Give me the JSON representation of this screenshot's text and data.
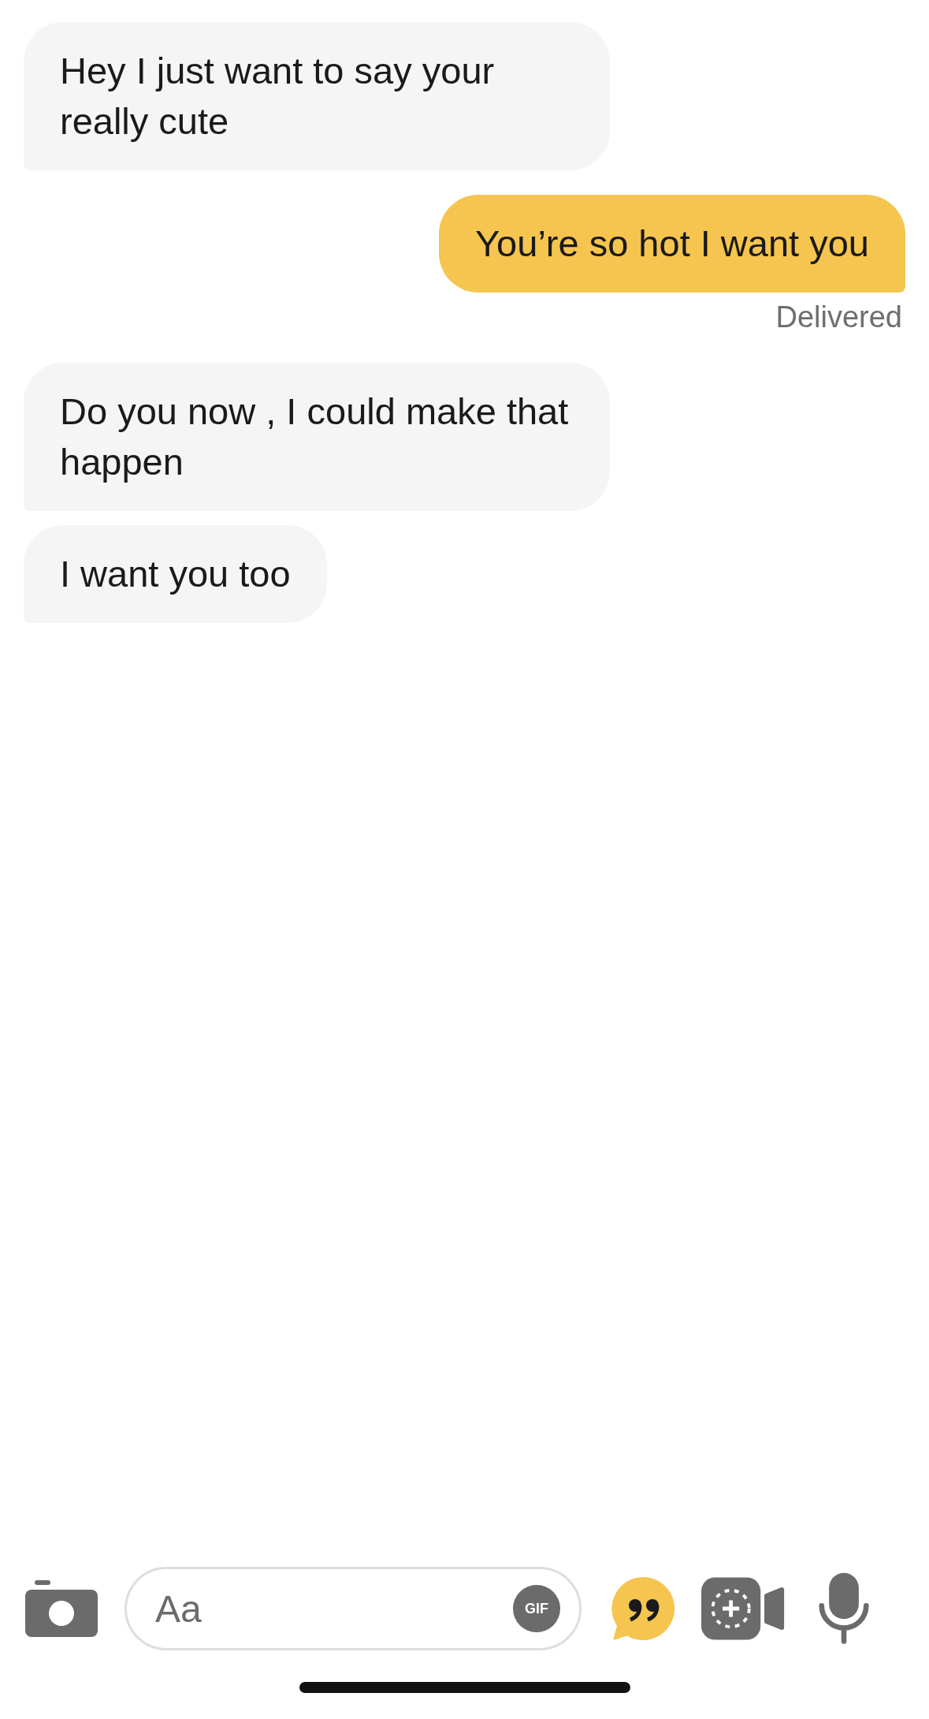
{
  "messages": [
    {
      "kind": "received",
      "text": "Hey I just want to say your really cute"
    },
    {
      "kind": "sent",
      "text": "You’re so hot I want you",
      "status": "Delivered"
    },
    {
      "kind": "received",
      "text": "Do you now , I could make that happen"
    },
    {
      "kind": "received",
      "text": "I want you too"
    }
  ],
  "composer": {
    "placeholder": "Aa",
    "gif_label": "GIF"
  }
}
